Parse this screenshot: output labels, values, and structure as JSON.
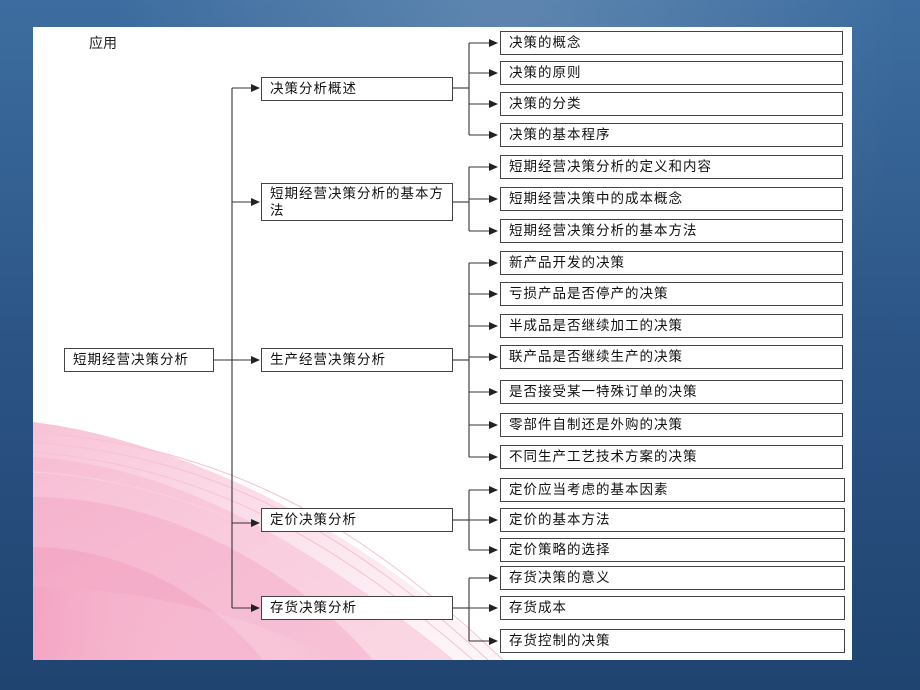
{
  "header": {
    "label": "应用"
  },
  "root": {
    "label": "短期经营决策分析"
  },
  "branches": [
    {
      "label": "决策分析概述",
      "children": [
        "决策的概念",
        "决策的原则",
        "决策的分类",
        "决策的基本程序"
      ]
    },
    {
      "label": "短期经营决策分析的基本方法",
      "children": [
        "短期经营决策分析的定义和内容",
        "短期经营决策中的成本概念",
        "短期经营决策分析的基本方法"
      ]
    },
    {
      "label": "生产经营决策分析",
      "children": [
        "新产品开发的决策",
        "亏损产品是否停产的决策",
        "半成品是否继续加工的决策",
        "联产品是否继续生产的决策",
        "是否接受某一特殊订单的决策",
        "零部件自制还是外购的决策",
        "不同生产工艺技术方案的决策"
      ]
    },
    {
      "label": "定价决策分析",
      "children": [
        "定价应当考虑的基本因素",
        "定价的基本方法",
        "定价策略的选择"
      ]
    },
    {
      "label": "存货决策分析",
      "children": [
        "存货决策的意义",
        "存货成本",
        "存货控制的决策"
      ]
    }
  ],
  "colors": {
    "frame": "#2a5283",
    "accent_wave": "#f2a6c4",
    "line": "#333333"
  }
}
